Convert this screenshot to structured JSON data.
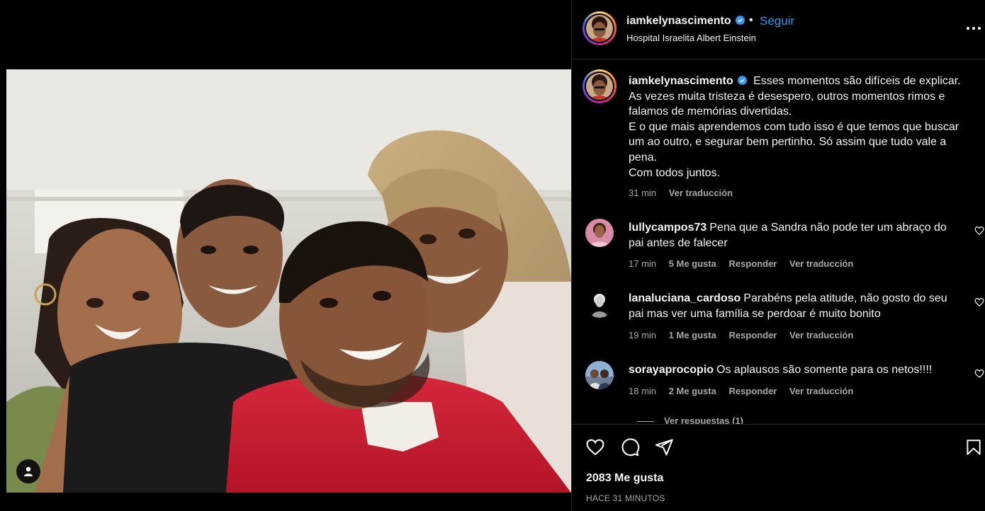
{
  "post": {
    "username": "iamkelynascimento",
    "follow_label": "Seguir",
    "separator": "•",
    "location": "Hospital Israelita Albert Einstein",
    "caption_lines": [
      "Esses momentos são difíceis de explicar.",
      "As vezes muita tristeza é desespero, outros momentos rimos e falamos de memórias divertidas.",
      "E o que mais aprendemos com tudo isso é que temos que buscar um ao outro, e segurar bem pertinho. Só assim que tudo vale a pena.",
      "Com todos juntos."
    ],
    "caption_time": "31 min",
    "caption_translate": "Ver traducción"
  },
  "comments": [
    {
      "username": "lullycampos73",
      "text": "Pena que a Sandra não pode ter um abraço do pai antes de falecer",
      "time": "17 min",
      "likes": "5 Me gusta",
      "reply": "Responder",
      "translate": "Ver traducción"
    },
    {
      "username": "lanaluciana_cardoso",
      "text": "Parabéns pela atitude, não gosto do seu pai mas ver uma família se perdoar é muito bonito",
      "time": "19 min",
      "likes": "1 Me gusta",
      "reply": "Responder",
      "translate": "Ver traducción"
    },
    {
      "username": "sorayaprocopio",
      "text": "Os aplausos são somente para os netos!!!!",
      "time": "18 min",
      "likes": "2 Me gusta",
      "reply": "Responder",
      "translate": "Ver traducción"
    }
  ],
  "view_replies": "Ver respuestas (1)",
  "footer": {
    "likes": "2083 Me gusta",
    "timestamp": "HACE 31 MINUTOS"
  },
  "icons": {
    "verified": "verified-badge-icon",
    "more": "more-options-icon",
    "like": "heart-icon",
    "comment": "comment-icon",
    "share": "share-icon",
    "save": "bookmark-icon",
    "tag": "user-tag-icon"
  },
  "colors": {
    "accent": "#1d9bf0",
    "verified": "#3897f0",
    "muted": "#a8a8a8"
  }
}
